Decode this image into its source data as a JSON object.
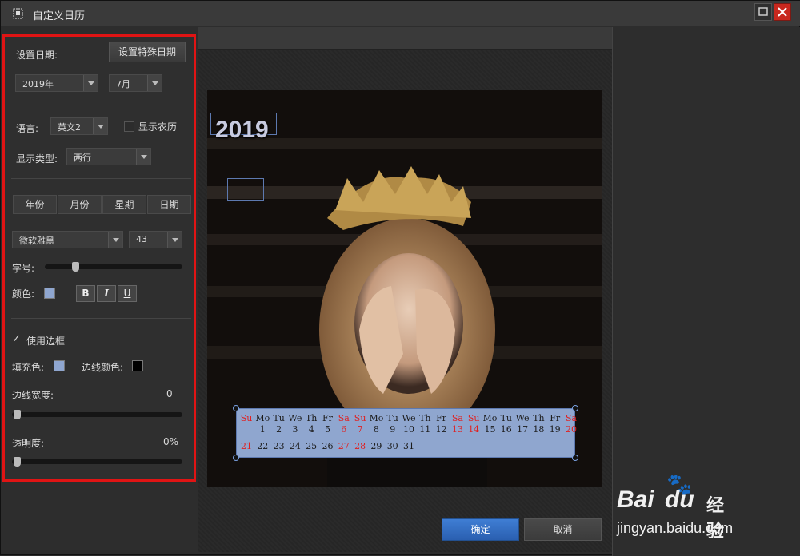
{
  "window": {
    "title": "自定义日历"
  },
  "left": {
    "set_date_label": "设置日期:",
    "special_date_button": "设置特殊日期",
    "year_select": "2019年",
    "month_select": "7月",
    "language_label": "语言:",
    "language_select": "英文2",
    "lunar_label": "显示农历",
    "lunar_checked": false,
    "display_type_label": "显示类型:",
    "display_type_select": "两行",
    "tabs": [
      "年份",
      "月份",
      "星期",
      "日期"
    ],
    "font_select": "微软雅黑",
    "size_select": "43",
    "font_size_label": "字号:",
    "font_size_slider": 0.22,
    "color_label": "颜色:",
    "text_color": "#8fa6cf",
    "bold_label": "B",
    "italic_label": "I",
    "underline_label": "U",
    "use_border_label": "使用边框",
    "use_border_checked": true,
    "fill_color_label": "填充色:",
    "fill_color": "#8fa6cf",
    "border_color_label": "边线颜色:",
    "border_color": "#000000",
    "border_width_label": "边线宽度:",
    "border_width_value": "0",
    "opacity_label": "透明度:",
    "opacity_value": "0%"
  },
  "preview": {
    "year_text": "2019",
    "weekdays": [
      "Su",
      "Mo",
      "Tu",
      "We",
      "Th",
      "Fr",
      "Sa",
      "Su",
      "Mo",
      "Tu",
      "We",
      "Th",
      "Fr",
      "Sa",
      "Su",
      "Mo",
      "Tu",
      "We",
      "Th",
      "Fr",
      "Sa"
    ],
    "week1": [
      "",
      "1",
      "2",
      "3",
      "4",
      "5",
      "6",
      "7",
      "8",
      "9",
      "10",
      "11",
      "12",
      "13",
      "14",
      "15",
      "16",
      "17",
      "18",
      "19",
      "20"
    ],
    "week2": [
      "21",
      "22",
      "23",
      "24",
      "25",
      "26",
      "27",
      "28",
      "29",
      "30",
      "31"
    ],
    "red_weekday_indices": [
      0,
      6,
      7,
      13,
      14,
      20
    ],
    "accent_color": "#e02020"
  },
  "footer": {
    "ok_label": "确定",
    "cancel_label": "取消"
  },
  "watermark": {
    "brand": "Bai",
    "brand2": "du",
    "sub": "经验",
    "url": "jingyan.baidu.com"
  }
}
